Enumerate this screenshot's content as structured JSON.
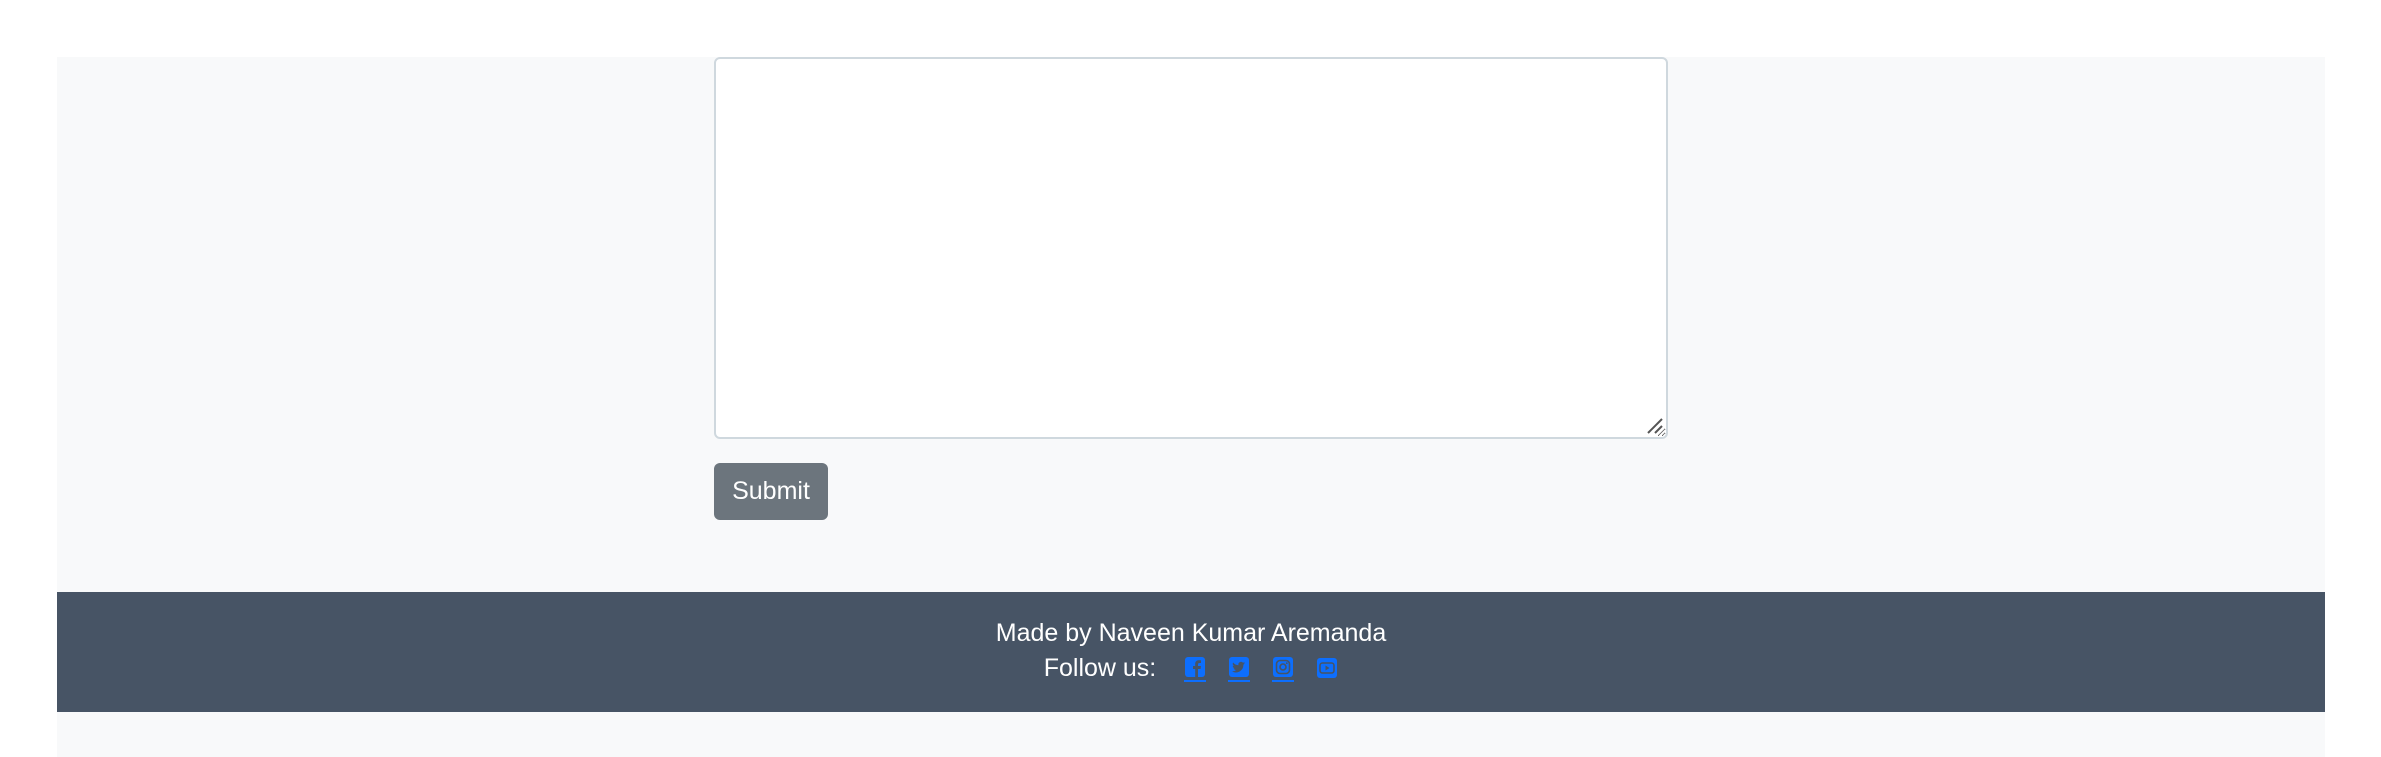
{
  "form": {
    "message_value": "",
    "submit_label": "Submit"
  },
  "footer": {
    "credit": "Made by Naveen Kumar Aremanda",
    "follow_label": "Follow us:",
    "social_icons": [
      "facebook-icon",
      "twitter-icon",
      "instagram-icon",
      "youtube-icon"
    ],
    "background_color": "#475465",
    "link_color": "#0d6efd"
  },
  "colors": {
    "page_background": "#f8f9fa",
    "submit_button": "#6c757d"
  }
}
